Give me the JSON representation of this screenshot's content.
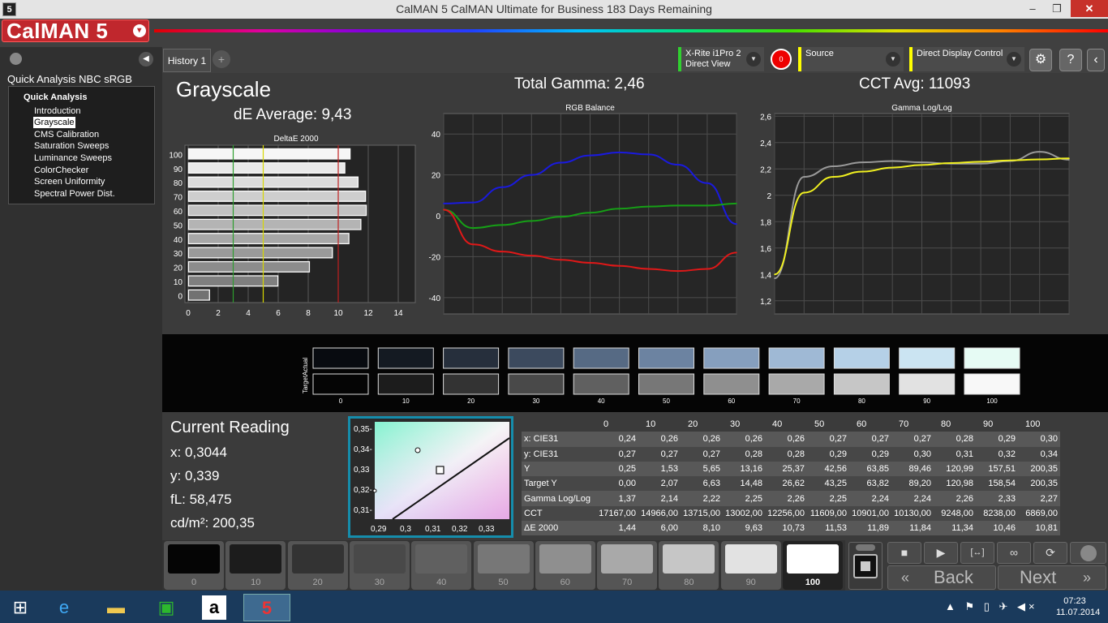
{
  "window": {
    "title": "CalMAN 5 CalMAN Ultimate for Business 183 Days Remaining",
    "app_icon": "5",
    "min": "–",
    "max": "❐",
    "close": "✕"
  },
  "logo": {
    "text": "CalMAN 5",
    "dropdown": "▾"
  },
  "left_panel": {
    "workflow_title": "Quick Analysis NBC sRGB",
    "root": "Quick Analysis",
    "items": [
      "Introduction",
      "Grayscale",
      "CMS Calibration",
      "Saturation Sweeps",
      "Luminance Sweeps",
      "ColorChecker",
      "Screen Uniformity",
      "Spectral Power Dist."
    ],
    "selected": "Grayscale",
    "collapse_icon": "◀"
  },
  "tabs": {
    "history": "History 1",
    "add": "+"
  },
  "devices": {
    "meter_line1": "X-Rite i1Pro 2",
    "meter_line2": "Direct View",
    "record": "0",
    "source": "Source",
    "display": "Direct Display Control"
  },
  "header": {
    "section": "Grayscale",
    "de_average": "dE Average: 9,43",
    "total_gamma": "Total Gamma: 2,46",
    "cct_avg": "CCT Avg: 11093"
  },
  "chart_data": [
    {
      "type": "bar",
      "title": "DeltaE 2000",
      "categories": [
        "0",
        "10",
        "20",
        "30",
        "40",
        "50",
        "60",
        "70",
        "80",
        "90",
        "100"
      ],
      "values": [
        1.44,
        6.0,
        8.1,
        9.63,
        10.73,
        11.53,
        11.89,
        11.84,
        11.34,
        10.46,
        10.81
      ],
      "xlim": [
        0,
        15
      ],
      "xticks": [
        "0",
        "2",
        "4",
        "6",
        "8",
        "10",
        "12",
        "14"
      ],
      "reference_lines": [
        {
          "value": 3,
          "color": "#2e9e2e"
        },
        {
          "value": 5,
          "color": "#d8d800"
        },
        {
          "value": 10,
          "color": "#c02020"
        }
      ]
    },
    {
      "type": "line",
      "title": "RGB Balance",
      "x": [
        0,
        10,
        20,
        30,
        40,
        50,
        60,
        70,
        80,
        90,
        100
      ],
      "series": [
        {
          "color": "#1a1adf",
          "values": [
            6,
            6.5,
            14,
            20,
            26,
            29.5,
            31,
            30,
            25,
            16,
            -4
          ]
        },
        {
          "color": "#16a016",
          "values": [
            3,
            -6,
            -4.5,
            -2.5,
            -0.5,
            1.5,
            3.5,
            4.5,
            5,
            5,
            6
          ]
        },
        {
          "color": "#e01818",
          "values": [
            3,
            -14,
            -17.5,
            -19.5,
            -21.5,
            -23,
            -24.5,
            -26,
            -27,
            -26,
            -18
          ]
        }
      ],
      "xlim": [
        0,
        100
      ],
      "ylim": [
        -48,
        50
      ],
      "xticks": [
        "0",
        "10",
        "20",
        "30",
        "40",
        "50",
        "60",
        "70",
        "80",
        "90",
        "100"
      ],
      "yticks": [
        "40",
        "20",
        "0",
        "-20",
        "-40"
      ]
    },
    {
      "type": "line",
      "title": "Gamma Log/Log",
      "x": [
        0,
        10,
        20,
        30,
        40,
        50,
        60,
        70,
        80,
        90,
        100
      ],
      "series": [
        {
          "color": "#9a9a9a",
          "values": [
            1.37,
            2.14,
            2.22,
            2.25,
            2.26,
            2.25,
            2.24,
            2.24,
            2.26,
            2.33,
            2.27
          ]
        },
        {
          "color": "#f0f020",
          "values": [
            1.4,
            2.02,
            2.14,
            2.18,
            2.21,
            2.23,
            2.245,
            2.255,
            2.265,
            2.272,
            2.28
          ]
        }
      ],
      "xlim": [
        0,
        100
      ],
      "ylim": [
        1.1,
        2.62
      ],
      "xticks": [
        "0",
        "10",
        "20",
        "30",
        "40",
        "50",
        "60",
        "70",
        "80",
        "90",
        "100"
      ],
      "yticks": [
        "2,6",
        "2,4",
        "2,2",
        "2",
        "1,8",
        "1,6",
        "1,4",
        "1,2"
      ]
    }
  ],
  "swatches": {
    "row_labels": [
      "Actual",
      "Target"
    ],
    "levels": [
      "0",
      "10",
      "20",
      "30",
      "40",
      "50",
      "60",
      "70",
      "80",
      "90",
      "100"
    ],
    "actual": [
      "#080b10",
      "#141a22",
      "#262f3c",
      "#3c4a5e",
      "#566a84",
      "#6c83a1",
      "#869fbe",
      "#9fb9d5",
      "#b5d0e7",
      "#cbe4f2",
      "#e6fbf4"
    ],
    "target": [
      "#050505",
      "#1c1c1c",
      "#333333",
      "#494949",
      "#606060",
      "#777777",
      "#8f8f8f",
      "#a9a9a9",
      "#c6c6c6",
      "#e2e2e2",
      "#f8f8f8"
    ]
  },
  "current_reading": {
    "title": "Current Reading",
    "x": "x: 0,3044",
    "y": "y: 0,339",
    "fl": "fL: 58,475",
    "cdm2": "cd/m²: 200,35"
  },
  "cie_plot": {
    "xticks": [
      "0,29",
      "0,3",
      "0,31",
      "0,32",
      "0,33"
    ],
    "yticks": [
      "0,35-",
      "0,34-",
      "0,33",
      "0,32-",
      "0,31-"
    ]
  },
  "table": {
    "columns": [
      "0",
      "10",
      "20",
      "30",
      "40",
      "50",
      "60",
      "70",
      "80",
      "90",
      "100"
    ],
    "rows": [
      {
        "label": "x: CIE31",
        "values": [
          "0,24",
          "0,26",
          "0,26",
          "0,26",
          "0,26",
          "0,27",
          "0,27",
          "0,27",
          "0,28",
          "0,29",
          "0,30"
        ]
      },
      {
        "label": "y: CIE31",
        "values": [
          "0,27",
          "0,27",
          "0,27",
          "0,28",
          "0,28",
          "0,29",
          "0,29",
          "0,30",
          "0,31",
          "0,32",
          "0,34"
        ]
      },
      {
        "label": "Y",
        "values": [
          "0,25",
          "1,53",
          "5,65",
          "13,16",
          "25,37",
          "42,56",
          "63,85",
          "89,46",
          "120,99",
          "157,51",
          "200,35"
        ]
      },
      {
        "label": "Target Y",
        "values": [
          "0,00",
          "2,07",
          "6,63",
          "14,48",
          "26,62",
          "43,25",
          "63,82",
          "89,20",
          "120,98",
          "158,54",
          "200,35"
        ]
      },
      {
        "label": "Gamma Log/Log",
        "values": [
          "1,37",
          "2,14",
          "2,22",
          "2,25",
          "2,26",
          "2,25",
          "2,24",
          "2,24",
          "2,26",
          "2,33",
          "2,27"
        ]
      },
      {
        "label": "CCT",
        "values": [
          "17167,00",
          "14966,00",
          "13715,00",
          "13002,00",
          "12256,00",
          "11609,00",
          "10901,00",
          "10130,00",
          "9248,00",
          "8238,00",
          "6869,00"
        ]
      },
      {
        "label": "ΔE 2000",
        "values": [
          "1,44",
          "6,00",
          "8,10",
          "9,63",
          "10,73",
          "11,53",
          "11,89",
          "11,84",
          "11,34",
          "10,46",
          "10,81"
        ]
      }
    ]
  },
  "patches": {
    "labels": [
      "0",
      "10",
      "20",
      "30",
      "40",
      "50",
      "60",
      "70",
      "80",
      "90",
      "100"
    ],
    "colors": [
      "#050505",
      "#1c1c1c",
      "#333333",
      "#494949",
      "#606060",
      "#777777",
      "#8f8f8f",
      "#a9a9a9",
      "#c6c6c6",
      "#e2e2e2",
      "#ffffff"
    ],
    "selected": "100"
  },
  "controls": {
    "stop": "■",
    "play": "▶",
    "fit": "[↔]",
    "loop": "∞",
    "refresh": "⟳",
    "back": "Back",
    "next": "Next",
    "back_icon": "«",
    "next_icon": "»"
  },
  "taskbar": {
    "time": "07:23",
    "date": "11.07.2014",
    "tray": "▲ ⚑ ▯ ✈ ◀×"
  }
}
